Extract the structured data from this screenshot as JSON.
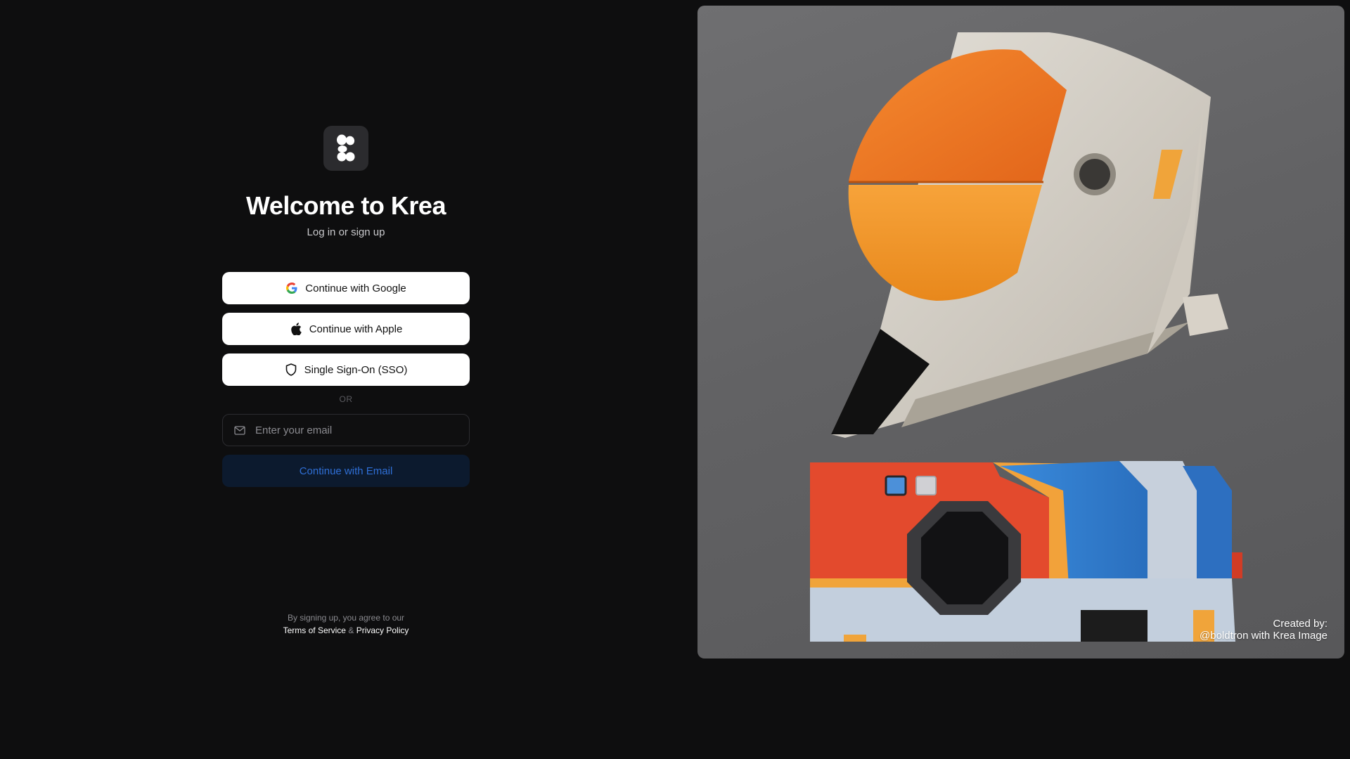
{
  "auth": {
    "title": "Welcome to Krea",
    "subtitle": "Log in or sign up",
    "google_label": "Continue with Google",
    "apple_label": "Continue with Apple",
    "sso_label": "Single Sign-On (SSO)",
    "divider": "OR",
    "email_placeholder": "Enter your email",
    "email_button": "Continue with Email",
    "legal_prefix": "By signing up, you agree to our",
    "terms_link": "Terms of Service",
    "ampersand": "&",
    "privacy_link": "Privacy Policy"
  },
  "art": {
    "credit_line1": "Created by:",
    "credit_line2": "@boldtron with Krea Image"
  },
  "icons": {
    "logo": "krea-logo-icon",
    "google": "google-icon",
    "apple": "apple-icon",
    "sso": "shield-icon",
    "email": "mail-icon"
  },
  "colors": {
    "background": "#0e0e0f",
    "primary_button": "#ffffff",
    "email_button_bg": "#0c1a2e",
    "email_button_text": "#2f6fd6",
    "link": "#ffffff"
  }
}
